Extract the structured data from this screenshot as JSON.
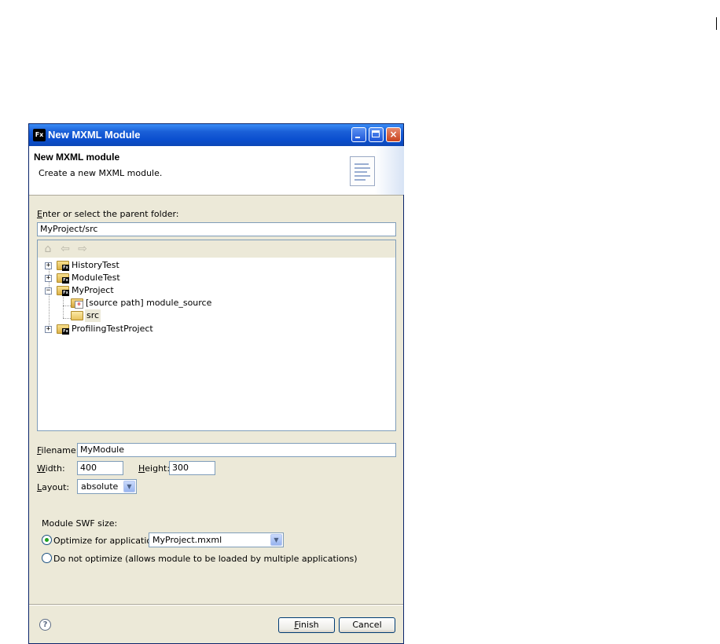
{
  "window": {
    "title": "New MXML Module",
    "app_icon_text": "Fx",
    "controls": {
      "minimize": "minimize",
      "maximize": "maximize",
      "close": "×"
    }
  },
  "header": {
    "title": "New MXML module",
    "description": "Create a new MXML module."
  },
  "parent_folder": {
    "label_first": "E",
    "label_rest": "nter or select the parent folder:",
    "value": "MyProject/src"
  },
  "tree_toolbar": {
    "home_icon": "home-icon",
    "back_icon": "back-arrow-icon",
    "forward_icon": "forward-arrow-icon"
  },
  "tree": {
    "items": [
      {
        "label": "HistoryTest",
        "expander": "+"
      },
      {
        "label": "ModuleTest",
        "expander": "+"
      },
      {
        "label": "MyProject",
        "expander": "−"
      },
      {
        "label": "[source path] module_source"
      },
      {
        "label": "src"
      },
      {
        "label": "ProfilingTestProject",
        "expander": "+"
      }
    ]
  },
  "filename": {
    "label_first": "F",
    "label_rest": "ilename:",
    "value": "MyModule"
  },
  "width": {
    "label_first": "W",
    "label_rest": "idth:",
    "value": "400"
  },
  "height": {
    "label_first": "H",
    "label_rest": "eight:",
    "value": "300"
  },
  "layout": {
    "label_first": "L",
    "label_rest": "ayout:",
    "value": "absolute"
  },
  "swf_size": {
    "group_label": "Module SWF size:",
    "optimize_label": "Optimize for application:",
    "optimize_value": "MyProject.mxml",
    "no_optimize_label": "Do not optimize (allows module to be loaded by multiple applications)",
    "selected": "optimize"
  },
  "footer": {
    "help": "?",
    "finish_first": "F",
    "finish_rest": "inish",
    "cancel": "Cancel"
  },
  "colors": {
    "titlebar": "#0b4fcf",
    "dialog_bg": "#ece9d8",
    "field_border": "#7f9db9",
    "radio_selected": "#21a121"
  }
}
